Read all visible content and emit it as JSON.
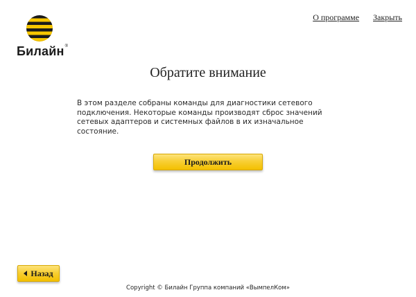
{
  "brand": {
    "name": "Билайн",
    "registered_mark": "®",
    "colors": {
      "yellow": "#f7c600",
      "black": "#1a1a1a"
    }
  },
  "header_links": {
    "about": "О программе",
    "close": "Закрыть"
  },
  "main": {
    "title": "Обратите внимание",
    "description": "В этом разделе собраны команды для диагностики сетевого подключения. Некоторые команды производят сброс значений сетевых адаптеров и системных файлов в их изначальное состояние.",
    "continue_label": "Продолжить"
  },
  "navigation": {
    "back_label": "Назад",
    "back_icon": "left-triangle-arrow-icon"
  },
  "footer": {
    "copyright": "Copyright © Билайн Группа компаний «ВымпелКом»"
  }
}
